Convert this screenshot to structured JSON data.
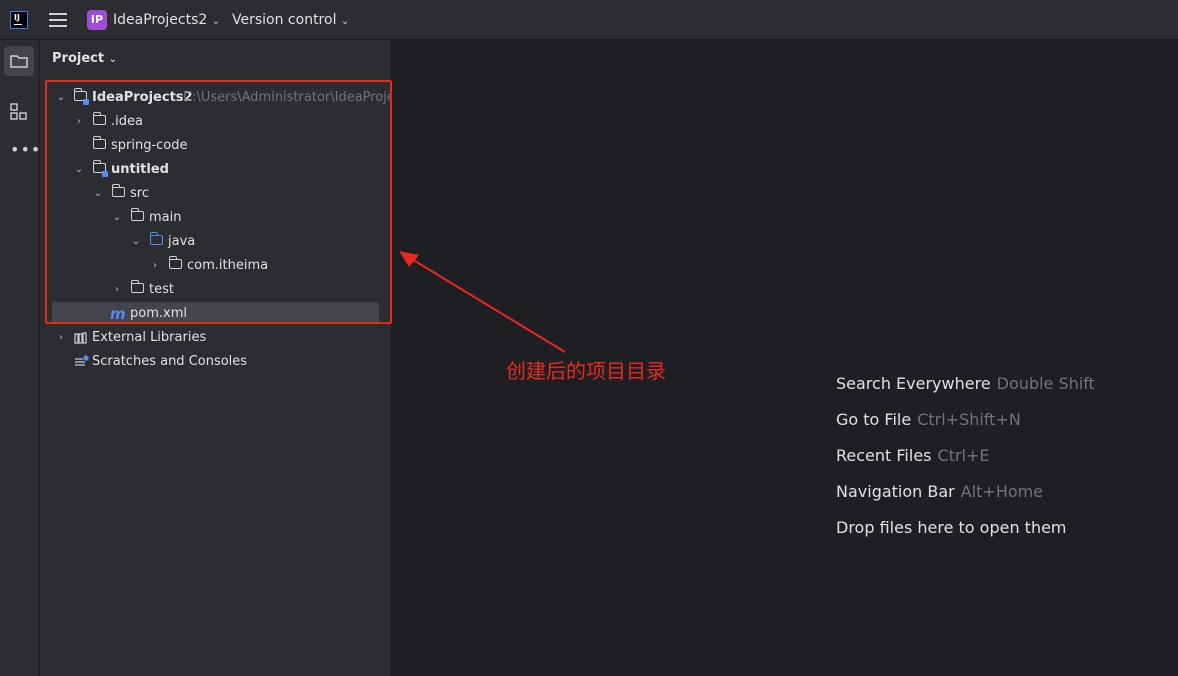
{
  "titlebar": {
    "project_badge": "IP",
    "project_name": "IdeaProjects2",
    "vcs_label": "Version control"
  },
  "project_panel": {
    "title": "Project",
    "tree": [
      {
        "label": "IdeaProjects2",
        "path": "C:\\Users\\Administrator\\IdeaProje"
      },
      {
        "label": ".idea"
      },
      {
        "label": "spring-code"
      },
      {
        "label": "untitled"
      },
      {
        "label": "src"
      },
      {
        "label": "main"
      },
      {
        "label": "java"
      },
      {
        "label": "com.itheima"
      },
      {
        "label": "test"
      },
      {
        "label": "pom.xml"
      },
      {
        "label": "External Libraries"
      },
      {
        "label": "Scratches and Consoles"
      }
    ]
  },
  "annotation": {
    "text": "创建后的项目目录",
    "color": "#e8281d"
  },
  "editor_hints": [
    {
      "action": "Search Everywhere",
      "shortcut": "Double Shift"
    },
    {
      "action": "Go to File",
      "shortcut": "Ctrl+Shift+N"
    },
    {
      "action": "Recent Files",
      "shortcut": "Ctrl+E"
    },
    {
      "action": "Navigation Bar",
      "shortcut": "Alt+Home"
    },
    {
      "action": "Drop files here to open them",
      "shortcut": ""
    }
  ],
  "icons": [
    "intellij-logo-icon",
    "hamburger-menu-icon",
    "folder-icon",
    "structure-icon",
    "more-icon",
    "chevron-down-icon",
    "chevron-right-icon",
    "maven-icon",
    "library-icon",
    "scratches-icon"
  ]
}
